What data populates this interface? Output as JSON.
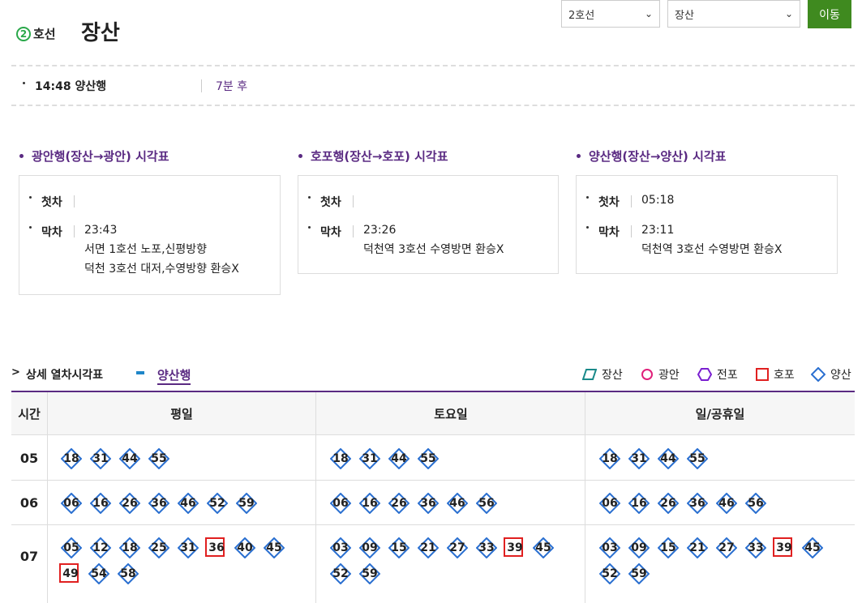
{
  "header": {
    "line_number": "2",
    "line_label": "호선",
    "station": "장산"
  },
  "selects": {
    "line": "2호선",
    "station": "장산",
    "go_label": "이동"
  },
  "next_train": {
    "time": "14:48 양산행",
    "remaining": "7분 후"
  },
  "summaries": [
    {
      "title": "광안행(장산→광안) 시각표",
      "first_label": "첫차",
      "first": "",
      "last_label": "막차",
      "last": "23:43",
      "notes": [
        "서면 1호선 노포,신평방향",
        "덕천 3호선 대저,수영방향 환승X"
      ]
    },
    {
      "title": "호포행(장산→호포) 시각표",
      "first_label": "첫차",
      "first": "",
      "last_label": "막차",
      "last": "23:26",
      "notes": [
        "덕천역 3호선 수영방면 환승X"
      ]
    },
    {
      "title": "양산행(장산→양산) 시각표",
      "first_label": "첫차",
      "first": "05:18",
      "last_label": "막차",
      "last": "23:11",
      "notes": [
        "덕천역 3호선 수영방면 환승X"
      ]
    }
  ],
  "detail": {
    "arrow": ">",
    "title": "상세 열차시각표",
    "direction": "양산행"
  },
  "legend": [
    {
      "label": "장산",
      "shape": "parallelogram",
      "color": "#1a8a8a"
    },
    {
      "label": "광안",
      "shape": "circle",
      "color": "#e0207a"
    },
    {
      "label": "전포",
      "shape": "hexagon",
      "color": "#7a1fd0"
    },
    {
      "label": "호포",
      "shape": "square",
      "color": "#e02020"
    },
    {
      "label": "양산",
      "shape": "diamond",
      "color": "#2a6fd0"
    }
  ],
  "table": {
    "headers": [
      "시간",
      "평일",
      "토요일",
      "일/공휴일"
    ],
    "rows": [
      {
        "hour": "05",
        "weekday": [
          [
            "18",
            "양산"
          ],
          [
            "31",
            "양산"
          ],
          [
            "44",
            "양산"
          ],
          [
            "55",
            "양산"
          ]
        ],
        "saturday": [
          [
            "18",
            "양산"
          ],
          [
            "31",
            "양산"
          ],
          [
            "44",
            "양산"
          ],
          [
            "55",
            "양산"
          ]
        ],
        "holiday": [
          [
            "18",
            "양산"
          ],
          [
            "31",
            "양산"
          ],
          [
            "44",
            "양산"
          ],
          [
            "55",
            "양산"
          ]
        ]
      },
      {
        "hour": "06",
        "weekday": [
          [
            "06",
            "양산"
          ],
          [
            "16",
            "양산"
          ],
          [
            "26",
            "양산"
          ],
          [
            "36",
            "양산"
          ],
          [
            "46",
            "양산"
          ],
          [
            "52",
            "양산"
          ],
          [
            "59",
            "양산"
          ]
        ],
        "saturday": [
          [
            "06",
            "양산"
          ],
          [
            "16",
            "양산"
          ],
          [
            "26",
            "양산"
          ],
          [
            "36",
            "양산"
          ],
          [
            "46",
            "양산"
          ],
          [
            "56",
            "양산"
          ]
        ],
        "holiday": [
          [
            "06",
            "양산"
          ],
          [
            "16",
            "양산"
          ],
          [
            "26",
            "양산"
          ],
          [
            "36",
            "양산"
          ],
          [
            "46",
            "양산"
          ],
          [
            "56",
            "양산"
          ]
        ]
      },
      {
        "hour": "07",
        "weekday": [
          [
            "05",
            "양산"
          ],
          [
            "12",
            "양산"
          ],
          [
            "18",
            "양산"
          ],
          [
            "25",
            "양산"
          ],
          [
            "31",
            "양산"
          ],
          [
            "36",
            "호포"
          ],
          [
            "40",
            "양산"
          ],
          [
            "45",
            "양산"
          ],
          [
            "49",
            "호포"
          ],
          [
            "54",
            "양산"
          ],
          [
            "58",
            "양산"
          ]
        ],
        "saturday": [
          [
            "03",
            "양산"
          ],
          [
            "09",
            "양산"
          ],
          [
            "15",
            "양산"
          ],
          [
            "21",
            "양산"
          ],
          [
            "27",
            "양산"
          ],
          [
            "33",
            "양산"
          ],
          [
            "39",
            "호포"
          ],
          [
            "45",
            "양산"
          ],
          [
            "52",
            "양산"
          ],
          [
            "59",
            "양산"
          ]
        ],
        "holiday": [
          [
            "03",
            "양산"
          ],
          [
            "09",
            "양산"
          ],
          [
            "15",
            "양산"
          ],
          [
            "21",
            "양산"
          ],
          [
            "27",
            "양산"
          ],
          [
            "33",
            "양산"
          ],
          [
            "39",
            "호포"
          ],
          [
            "45",
            "양산"
          ],
          [
            "52",
            "양산"
          ],
          [
            "59",
            "양산"
          ]
        ]
      }
    ]
  }
}
